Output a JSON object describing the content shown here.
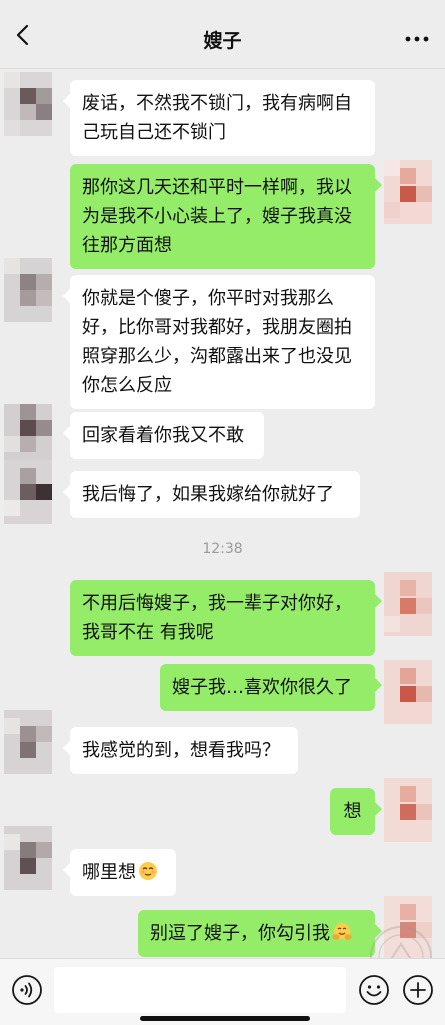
{
  "header": {
    "title": "嫂子",
    "back_icon": "chevron-left-icon",
    "more_icon": "more-dots-icon"
  },
  "messages": [
    {
      "side": "left",
      "text": "废话，不然我不锁门，我有病啊自己玩自己还不锁门"
    },
    {
      "side": "right",
      "text": "那你这几天还和平时一样啊，我以为是我不小心装上了，嫂子我真没往那方面想"
    },
    {
      "side": "left",
      "text": "你就是个傻子，你平时对我那么好，比你哥对我都好，我朋友圈拍照穿那么少，沟都露出来了也没见你怎么反应"
    },
    {
      "side": "left",
      "text": "回家看着你我又不敢"
    },
    {
      "side": "left",
      "text": "我后悔了，如果我嫁给你就好了"
    },
    {
      "side": "right",
      "text": "不用后悔嫂子，我一辈子对你好，我哥不在 有我呢"
    },
    {
      "side": "right",
      "text": "嫂子我…喜欢你很久了"
    },
    {
      "side": "left",
      "text": "我感觉的到，想看我吗？"
    },
    {
      "side": "right",
      "text": "想"
    },
    {
      "side": "left",
      "text": "哪里想",
      "emoji": "relieved-face-emoji"
    },
    {
      "side": "right",
      "text": "别逗了嫂子，你勾引我",
      "emoji": "hugging-face-emoji"
    }
  ],
  "timestamp": "12:38",
  "input_bar": {
    "voice_icon": "voice-icon",
    "emoji_icon": "emoji-face-icon",
    "plus_icon": "plus-icon"
  },
  "colors": {
    "background": "#ededed",
    "bubble_right": "#95ec69",
    "bubble_left": "#ffffff"
  }
}
